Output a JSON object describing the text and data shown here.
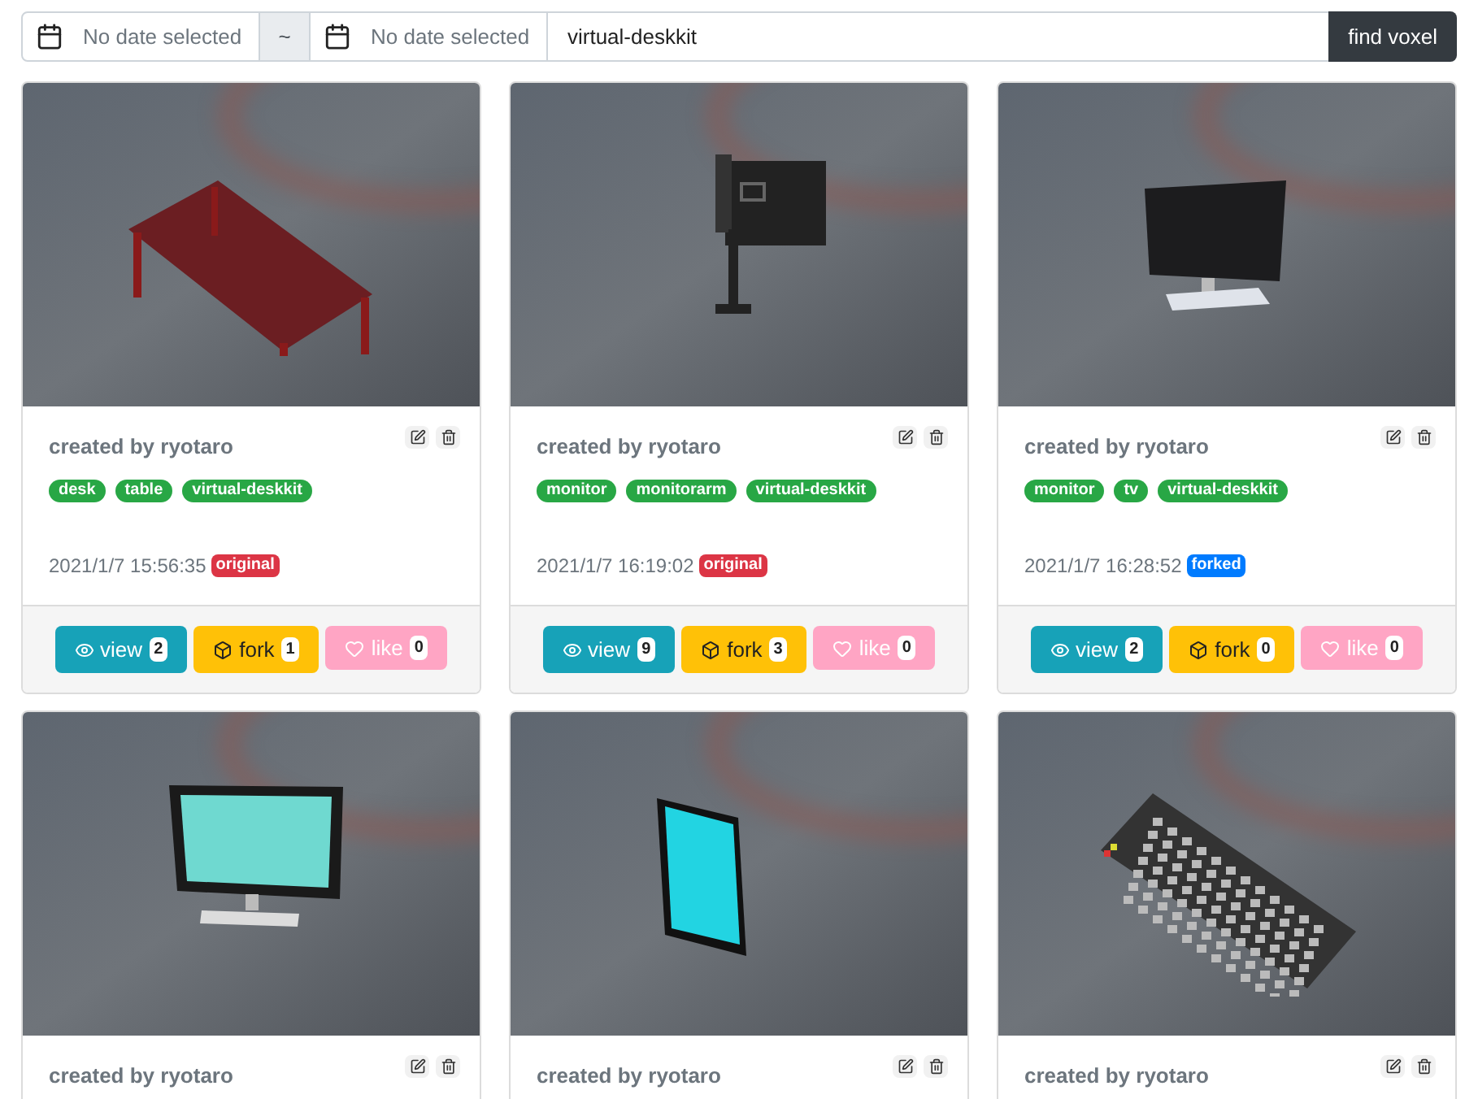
{
  "search": {
    "date_from": {
      "placeholder": "No date selected"
    },
    "separator": "~",
    "date_to": {
      "placeholder": "No date selected"
    },
    "query": "virtual-deskkit",
    "button": "find voxel"
  },
  "cards": [
    {
      "kind": "desk",
      "author": "created by ryotaro",
      "tags": [
        "desk",
        "table",
        "virtual-deskkit"
      ],
      "date": "2021/1/7 15:56:35",
      "origin": {
        "label": "original",
        "kind": "original"
      },
      "actions": {
        "view": {
          "label": "view",
          "count": "2"
        },
        "fork": {
          "label": "fork",
          "count": "1"
        },
        "like": {
          "label": "like",
          "count": "0"
        }
      }
    },
    {
      "kind": "monitorarm",
      "author": "created by ryotaro",
      "tags": [
        "monitor",
        "monitorarm",
        "virtual-deskkit"
      ],
      "date": "2021/1/7 16:19:02",
      "origin": {
        "label": "original",
        "kind": "original"
      },
      "actions": {
        "view": {
          "label": "view",
          "count": "9"
        },
        "fork": {
          "label": "fork",
          "count": "3"
        },
        "like": {
          "label": "like",
          "count": "0"
        }
      }
    },
    {
      "kind": "monitor",
      "author": "created by ryotaro",
      "tags": [
        "monitor",
        "tv",
        "virtual-deskkit"
      ],
      "date": "2021/1/7 16:28:52",
      "origin": {
        "label": "forked",
        "kind": "forked"
      },
      "actions": {
        "view": {
          "label": "view",
          "count": "2"
        },
        "fork": {
          "label": "fork",
          "count": "0"
        },
        "like": {
          "label": "like",
          "count": "0"
        }
      }
    },
    {
      "kind": "screen",
      "author": "created by ryotaro"
    },
    {
      "kind": "panel",
      "author": "created by ryotaro"
    },
    {
      "kind": "keyboard",
      "author": "created by ryotaro"
    }
  ]
}
